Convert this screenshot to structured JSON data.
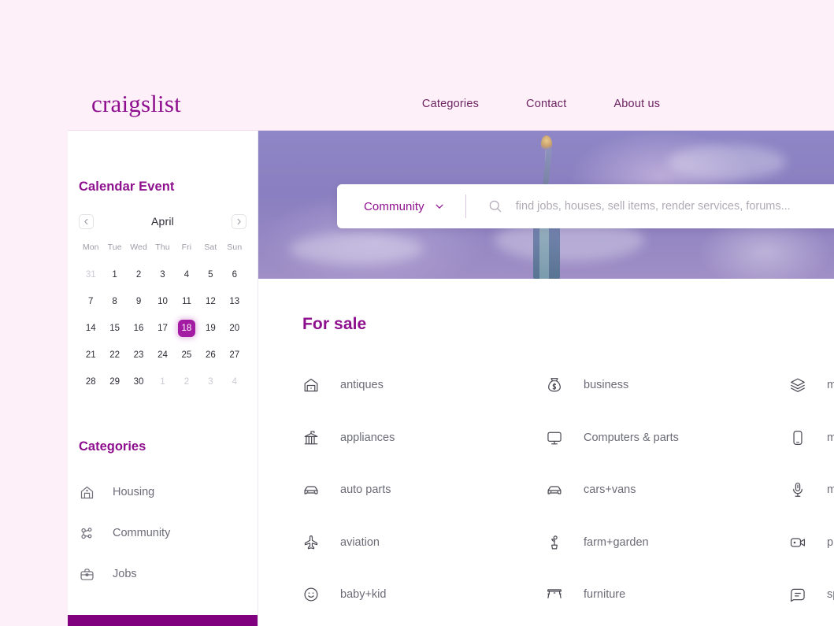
{
  "header": {
    "logo": "craigslist",
    "nav": [
      {
        "label": "Categories"
      },
      {
        "label": "Contact"
      },
      {
        "label": "About us"
      }
    ]
  },
  "sidebar": {
    "calendar": {
      "title": "Calendar Event",
      "month": "April",
      "prev_icon": "chevron-left-icon",
      "next_icon": "chevron-right-icon",
      "weekdays": [
        "Mon",
        "Tue",
        "Wed",
        "Thu",
        "Fri",
        "Sat",
        "Sun"
      ],
      "selected_day": 18,
      "days": [
        {
          "n": "31",
          "muted": true
        },
        {
          "n": "1"
        },
        {
          "n": "2"
        },
        {
          "n": "3"
        },
        {
          "n": "4"
        },
        {
          "n": "5"
        },
        {
          "n": "6"
        },
        {
          "n": "7"
        },
        {
          "n": "8"
        },
        {
          "n": "9"
        },
        {
          "n": "10"
        },
        {
          "n": "11"
        },
        {
          "n": "12"
        },
        {
          "n": "13"
        },
        {
          "n": "14"
        },
        {
          "n": "15"
        },
        {
          "n": "16"
        },
        {
          "n": "17"
        },
        {
          "n": "18",
          "selected": true
        },
        {
          "n": "19"
        },
        {
          "n": "20"
        },
        {
          "n": "21"
        },
        {
          "n": "22"
        },
        {
          "n": "23"
        },
        {
          "n": "24"
        },
        {
          "n": "25"
        },
        {
          "n": "26"
        },
        {
          "n": "27"
        },
        {
          "n": "28"
        },
        {
          "n": "29"
        },
        {
          "n": "30"
        },
        {
          "n": "1",
          "muted": true
        },
        {
          "n": "2",
          "muted": true
        },
        {
          "n": "3",
          "muted": true
        },
        {
          "n": "4",
          "muted": true
        }
      ]
    },
    "categories": {
      "title": "Categories",
      "items": [
        {
          "label": "Housing",
          "icon": "home-icon"
        },
        {
          "label": "Community",
          "icon": "people-icon"
        },
        {
          "label": "Jobs",
          "icon": "briefcase-icon"
        }
      ]
    }
  },
  "hero": {
    "image_alt": "statue-of-liberty-banner",
    "search": {
      "category": "Community",
      "dropdown_icon": "chevron-down-icon",
      "search_icon": "search-icon",
      "placeholder": "find jobs, houses, sell items, render services, forums...",
      "value": ""
    }
  },
  "for_sale": {
    "title": "For sale",
    "columns": [
      [
        {
          "label": "antiques",
          "icon": "barn-icon"
        },
        {
          "label": "appliances",
          "icon": "appliance-icon"
        },
        {
          "label": "auto parts",
          "icon": "car-icon"
        },
        {
          "label": "aviation",
          "icon": "airplane-icon"
        },
        {
          "label": "baby+kid",
          "icon": "smiley-icon"
        }
      ],
      [
        {
          "label": "business",
          "icon": "money-bag-icon"
        },
        {
          "label": "Computers & parts",
          "icon": "monitor-icon"
        },
        {
          "label": "cars+vans",
          "icon": "car-icon"
        },
        {
          "label": "farm+garden",
          "icon": "plant-icon"
        },
        {
          "label": "furniture",
          "icon": "table-icon"
        }
      ],
      [
        {
          "label": "materials",
          "icon": "layers-icon"
        },
        {
          "label": "mobile phones",
          "icon": "phone-icon"
        },
        {
          "label": "musical instruments",
          "icon": "microphone-icon"
        },
        {
          "label": "photo+video",
          "icon": "video-camera-icon"
        },
        {
          "label": "sporting goods",
          "icon": "message-icon"
        }
      ]
    ]
  },
  "colors": {
    "brand_purple": "#8e0f8e",
    "accent_magenta": "#a31aa3",
    "page_bg": "#fdf0f9",
    "bottom_bar": "#800080"
  }
}
